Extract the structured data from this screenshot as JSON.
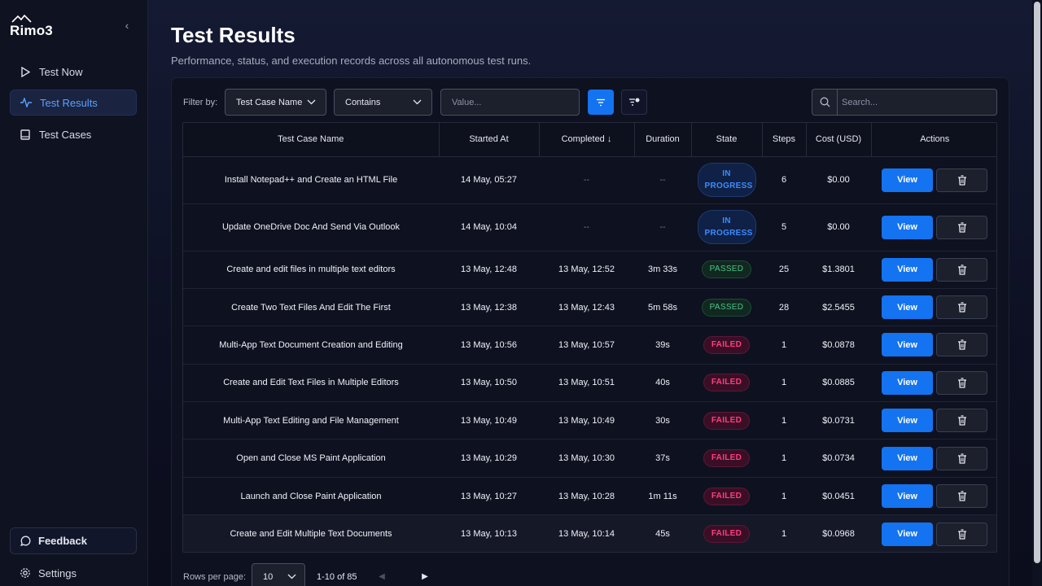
{
  "app": {
    "brand": "Rimo3"
  },
  "sidebar": {
    "items": [
      {
        "label": "Test Now",
        "icon": "play-icon",
        "active": false
      },
      {
        "label": "Test Results",
        "icon": "activity-icon",
        "active": true
      },
      {
        "label": "Test Cases",
        "icon": "book-icon",
        "active": false
      }
    ],
    "feedback_label": "Feedback",
    "settings_label": "Settings"
  },
  "header": {
    "title": "Test Results",
    "subtitle": "Performance, status, and execution records across all autonomous test runs."
  },
  "filters": {
    "label": "Filter by:",
    "field_select": "Test Case Name",
    "operator_select": "Contains",
    "value_placeholder": "Value...",
    "search_placeholder": "Search..."
  },
  "table": {
    "columns": [
      "Test Case Name",
      "Started At",
      "Completed ↓",
      "Duration",
      "State",
      "Steps",
      "Cost (USD)",
      "Actions"
    ],
    "view_label": "View",
    "rows": [
      {
        "name": "Install Notepad++ and Create an HTML File",
        "started": "14 May, 05:27",
        "completed": "--",
        "duration": "--",
        "state": "IN PROGRESS",
        "steps": "6",
        "cost": "$0.00"
      },
      {
        "name": "Update OneDrive Doc And Send Via Outlook",
        "started": "14 May, 10:04",
        "completed": "--",
        "duration": "--",
        "state": "IN PROGRESS",
        "steps": "5",
        "cost": "$0.00"
      },
      {
        "name": "Create and edit files in multiple text editors",
        "started": "13 May, 12:48",
        "completed": "13 May, 12:52",
        "duration": "3m 33s",
        "state": "PASSED",
        "steps": "25",
        "cost": "$1.3801"
      },
      {
        "name": "Create Two Text Files And Edit The First",
        "started": "13 May, 12:38",
        "completed": "13 May, 12:43",
        "duration": "5m 58s",
        "state": "PASSED",
        "steps": "28",
        "cost": "$2.5455"
      },
      {
        "name": "Multi-App Text Document Creation and Editing",
        "started": "13 May, 10:56",
        "completed": "13 May, 10:57",
        "duration": "39s",
        "state": "FAILED",
        "steps": "1",
        "cost": "$0.0878"
      },
      {
        "name": "Create and Edit Text Files in Multiple Editors",
        "started": "13 May, 10:50",
        "completed": "13 May, 10:51",
        "duration": "40s",
        "state": "FAILED",
        "steps": "1",
        "cost": "$0.0885"
      },
      {
        "name": "Multi-App Text Editing and File Management",
        "started": "13 May, 10:49",
        "completed": "13 May, 10:49",
        "duration": "30s",
        "state": "FAILED",
        "steps": "1",
        "cost": "$0.0731"
      },
      {
        "name": "Open and Close MS Paint Application",
        "started": "13 May, 10:29",
        "completed": "13 May, 10:30",
        "duration": "37s",
        "state": "FAILED",
        "steps": "1",
        "cost": "$0.0734"
      },
      {
        "name": "Launch and Close Paint Application",
        "started": "13 May, 10:27",
        "completed": "13 May, 10:28",
        "duration": "1m 11s",
        "state": "FAILED",
        "steps": "1",
        "cost": "$0.0451"
      },
      {
        "name": "Create and Edit Multiple Text Documents",
        "started": "13 May, 10:13",
        "completed": "13 May, 10:14",
        "duration": "45s",
        "state": "FAILED",
        "steps": "1",
        "cost": "$0.0968"
      }
    ]
  },
  "pagination": {
    "rows_per_page_label": "Rows per page:",
    "rows_per_page": "10",
    "range": "1-10 of 85"
  },
  "colors": {
    "accent": "#1473f0",
    "passed": "#4cc38a",
    "failed": "#ff3d7f",
    "in_progress": "#3e8bff"
  }
}
